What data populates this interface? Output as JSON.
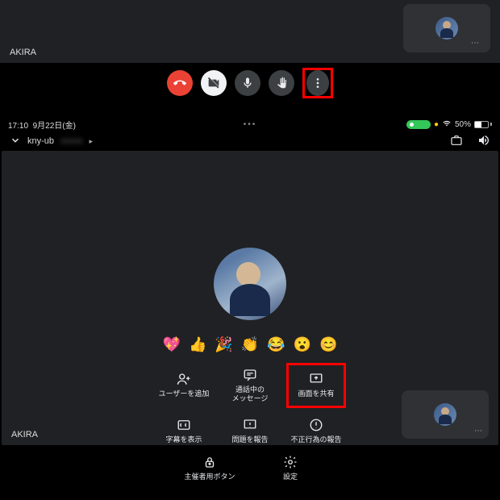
{
  "top": {
    "participant": "AKIRA",
    "controls": {
      "end": "通話を終了",
      "camera": "カメラ",
      "mic": "マイク",
      "hand": "挙手",
      "more": "その他"
    }
  },
  "bottom": {
    "status": {
      "time": "17:10",
      "date": "9月22日(金)",
      "battery_pct": "50%"
    },
    "meeting_id": "kny-ub",
    "participant": "AKIRA",
    "emojis": [
      "💖",
      "👍",
      "🎉",
      "👏",
      "😂",
      "😮",
      "😊"
    ],
    "menu": {
      "add_user": "ユーザーを追加",
      "chat": "通話中の\nメッセージ",
      "share": "画面を共有",
      "captions": "字幕を表示",
      "report_problem": "問題を報告",
      "report_abuse": "不正行為の報告",
      "host_controls": "主催者用ボタン",
      "settings": "設定"
    }
  }
}
